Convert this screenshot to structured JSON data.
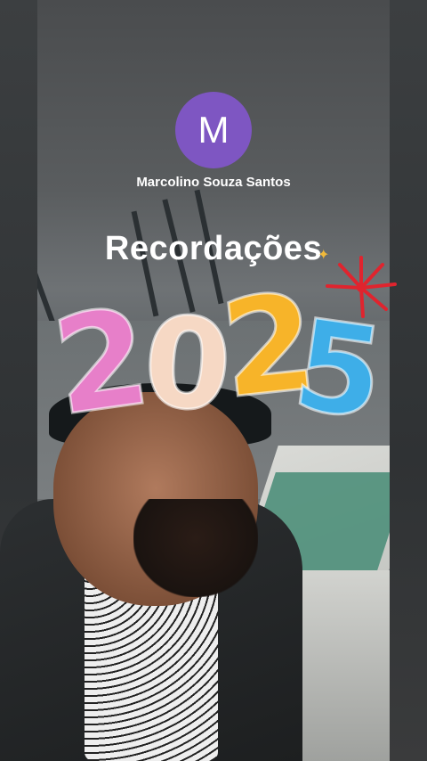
{
  "profile": {
    "avatar_letter": "M",
    "avatar_color": "#7e56c2",
    "name": "Marcolino Souza Santos"
  },
  "memory": {
    "title": "Recordações",
    "year_digits": [
      "2",
      "0",
      "2",
      "5"
    ]
  },
  "icons": {
    "sparkle": "sparkle-icon",
    "firework": "firework-icon"
  }
}
